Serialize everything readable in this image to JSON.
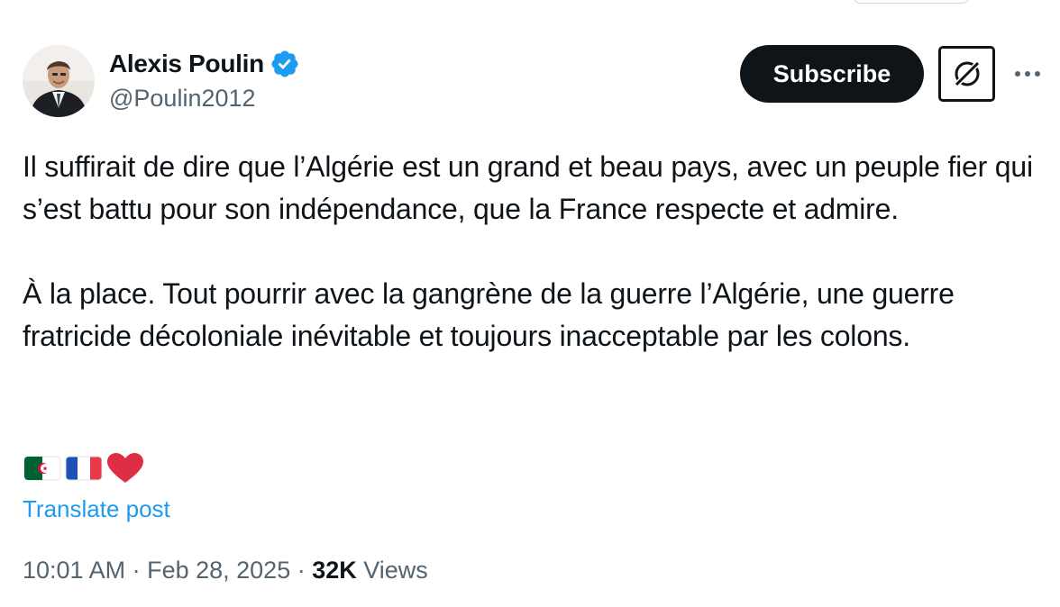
{
  "author": {
    "display_name": "Alexis Poulin",
    "handle": "@Poulin2012",
    "verified_color": "#1d9bf0",
    "avatar_icon": "profile-photo"
  },
  "actions": {
    "subscribe_label": "Subscribe",
    "grok_icon": "grok-icon",
    "more_icon": "more-horizontal-icon"
  },
  "post": {
    "paragraphs": [
      "Il suffirait de dire que l’Algérie est un grand et beau pays, avec un peuple fier qui s’est battu pour son indépendance, que la France respecte et admire.",
      "À la place. Tout pourrir avec la gangrène de la guerre l’Algérie, une guerre fratricide décoloniale inévitable et toujours inacceptable par les colons."
    ],
    "emojis": [
      "algeria-flag",
      "france-flag",
      "red-heart"
    ]
  },
  "translate_label": "Translate post",
  "meta": {
    "time": "10:01 AM",
    "separator": " · ",
    "date": "Feb 28, 2025",
    "views_count": "32K",
    "views_label": "Views"
  },
  "colors": {
    "text": "#0f1419",
    "secondary": "#536471",
    "link": "#1d9bf0"
  }
}
